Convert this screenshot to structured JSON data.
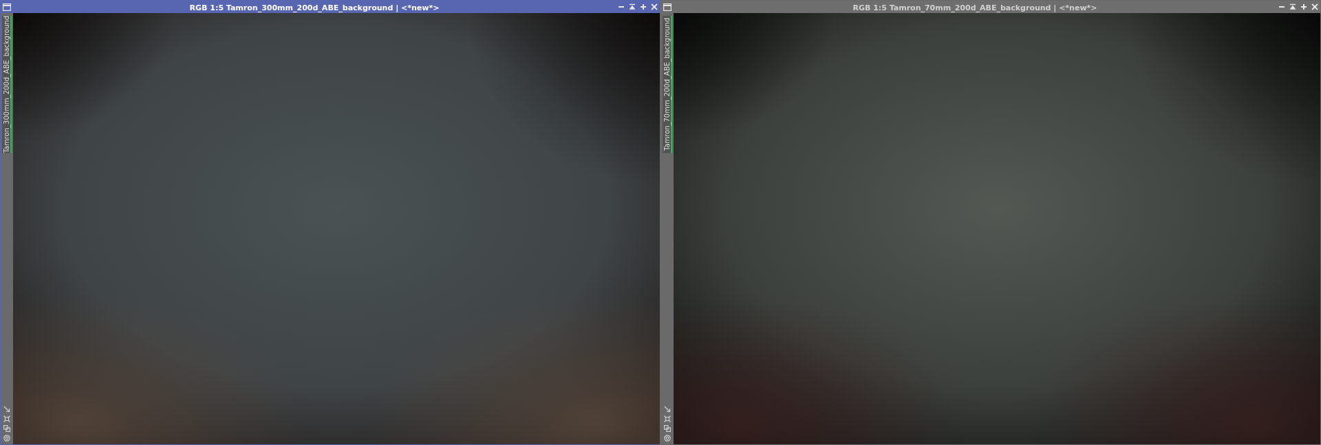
{
  "windows": [
    {
      "title": "RGB 1:5 Tamron_300mm_200d_ABE_background | <*new*>",
      "active": true,
      "tab": {
        "label": "Tamron_300mm_200d_ABE_background",
        "selected": true
      }
    },
    {
      "title": "RGB 1:5 Tamron_70mm_200d_ABE_background | <*new*>",
      "active": false,
      "tab": {
        "label": "Tamron_70mm_200d_ABE_background",
        "selected": true
      }
    }
  ]
}
